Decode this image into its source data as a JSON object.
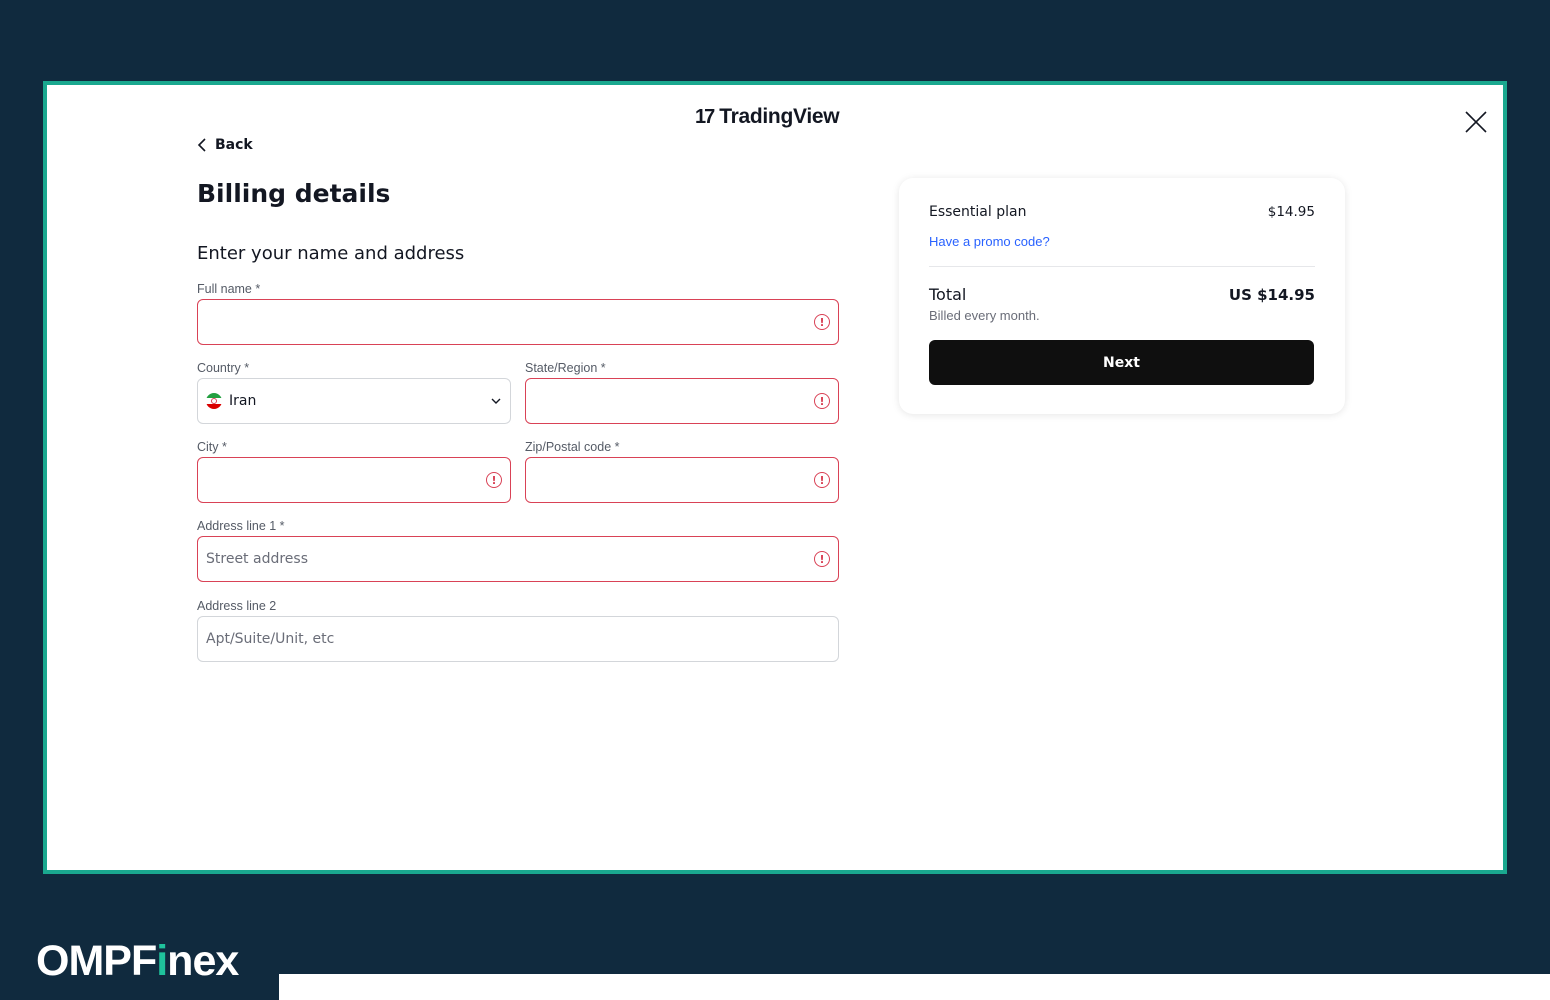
{
  "header": {
    "logo_mark": "17",
    "logo_text": "TradingView"
  },
  "nav": {
    "back_label": "Back"
  },
  "page": {
    "title": "Billing details",
    "section_title": "Enter your name and address"
  },
  "form": {
    "full_name": {
      "label": "Full name *",
      "value": "",
      "placeholder": ""
    },
    "country": {
      "label": "Country *",
      "value": "Iran"
    },
    "state": {
      "label": "State/Region *",
      "value": "",
      "placeholder": ""
    },
    "city": {
      "label": "City *",
      "value": "",
      "placeholder": ""
    },
    "zip": {
      "label": "Zip/Postal code *",
      "value": "",
      "placeholder": ""
    },
    "address1": {
      "label": "Address line 1 *",
      "value": "",
      "placeholder": "Street address"
    },
    "address2": {
      "label": "Address line 2",
      "value": "",
      "placeholder": "Apt/Suite/Unit, etc"
    },
    "error_icon": "!"
  },
  "summary": {
    "plan_name": "Essential plan",
    "plan_price": "$14.95",
    "promo_link": "Have a promo code?",
    "total_label": "Total",
    "total_value": "US $14.95",
    "billing_note": "Billed every month.",
    "next_label": "Next"
  },
  "brand": {
    "prefix": "OMPF",
    "accent": "i",
    "suffix": "nex"
  },
  "colors": {
    "background": "#102a3e",
    "frame_border": "#1aa88f",
    "error": "#d94256",
    "link": "#2962ff",
    "button": "#0f0f0f",
    "brand_accent": "#1fc29c"
  }
}
